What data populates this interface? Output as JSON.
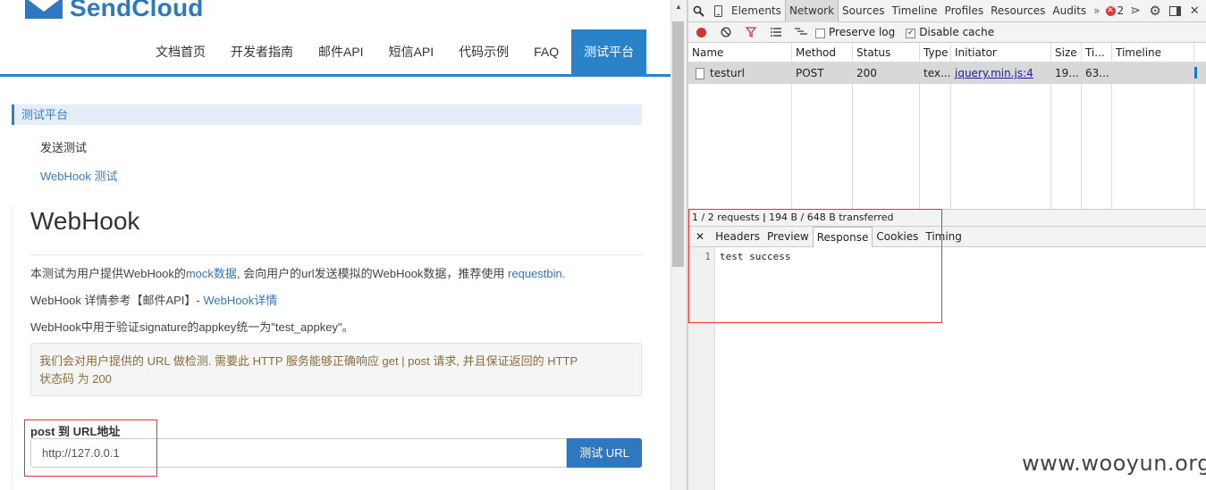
{
  "site": {
    "logo_text": "SendCloud",
    "nav": [
      {
        "label": "文档首页"
      },
      {
        "label": "开发者指南"
      },
      {
        "label": "邮件API"
      },
      {
        "label": "短信API"
      },
      {
        "label": "代码示例"
      },
      {
        "label": "FAQ"
      },
      {
        "label": "测试平台"
      }
    ],
    "sidebar": {
      "header": "测试平台",
      "items": [
        {
          "label": "发送测试"
        },
        {
          "label": "WebHook 测试"
        }
      ]
    },
    "content": {
      "title": "WebHook",
      "p1_a": "本测试为用户提供WebHook的",
      "p1_link1": "mock数据",
      "p1_b": ", 会向用户的url发送模拟的WebHook数据，推荐使用 ",
      "p1_link2": "requestbin",
      "p1_c": ".",
      "p2_a": "WebHook 详情参考【邮件API】- ",
      "p2_link": "WebHook详情",
      "p3": "WebHook中用于验证signature的appkey统一为\"test_appkey\"。",
      "alert_line1": "我们会对用户提供的 URL 做检测. 需要此 HTTP 服务能够正确响应 get | post 请求, 并且保证返回的 HTTP",
      "alert_line2": "状态码 为 200",
      "field_label": "post 到 URL地址",
      "field_value": "http://127.0.0.1",
      "button_label": "测试 URL"
    },
    "watermark": "www.wooyun.org"
  },
  "devtools": {
    "tabs": [
      "Elements",
      "Network",
      "Sources",
      "Timeline",
      "Profiles",
      "Resources",
      "Audits"
    ],
    "active_tab": "Network",
    "more": "»",
    "error_count": "2",
    "toolbar": {
      "preserve_log": "Preserve log",
      "disable_cache": "Disable cache"
    },
    "columns": [
      "Name",
      "Method",
      "Status",
      "Type",
      "Initiator",
      "Size",
      "Ti...",
      "Timeline"
    ],
    "rows": [
      {
        "name": "testurl",
        "method": "POST",
        "status": "200",
        "type": "tex...",
        "initiator": "jquery.min.js:4",
        "size": "19...",
        "time": "63..."
      }
    ],
    "summary": "1 / 2 requests  ǀ  194 B / 648 B transferred",
    "response_tabs": [
      "Headers",
      "Preview",
      "Response",
      "Cookies",
      "Timing"
    ],
    "active_response_tab": "Response",
    "response_lines": [
      {
        "num": "1",
        "text": "test success"
      }
    ]
  },
  "colors": {
    "brand": "#2f78c0",
    "nav_active": "#2a82c9",
    "highlight_box": "#e2333a"
  }
}
